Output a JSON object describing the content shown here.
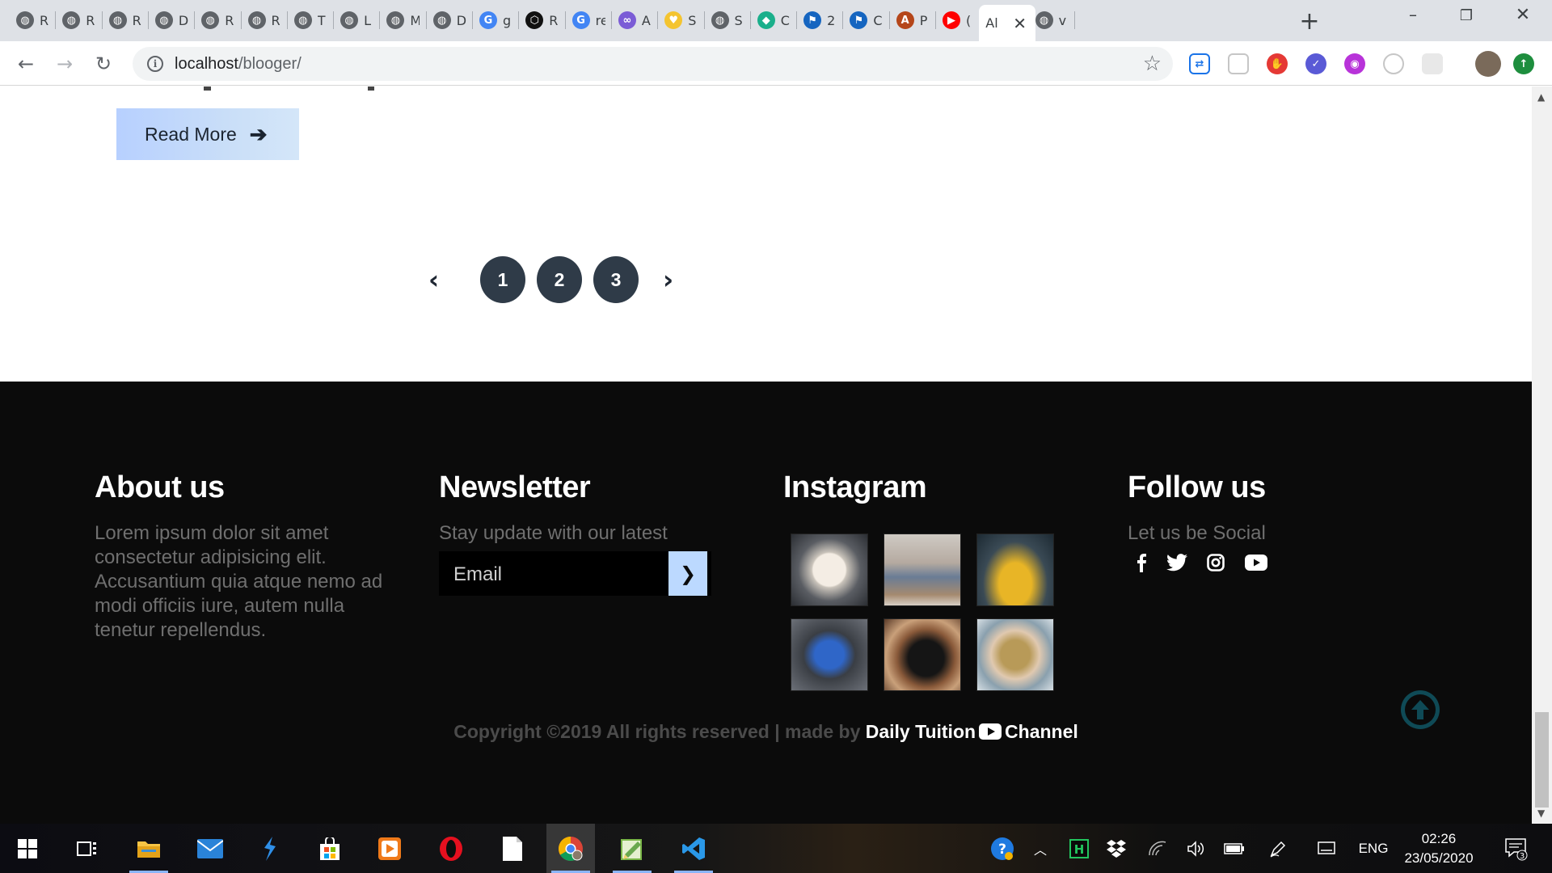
{
  "browser": {
    "tabs": [
      {
        "title": "R",
        "icon": "globe-icon",
        "color": "#5f6368"
      },
      {
        "title": "R",
        "icon": "globe-icon",
        "color": "#5f6368"
      },
      {
        "title": "R",
        "icon": "globe-icon",
        "color": "#5f6368"
      },
      {
        "title": "D",
        "icon": "globe-icon",
        "color": "#5f6368"
      },
      {
        "title": "R",
        "icon": "globe-icon",
        "color": "#5f6368"
      },
      {
        "title": "R",
        "icon": "globe-icon",
        "color": "#5f6368"
      },
      {
        "title": "T",
        "icon": "globe-icon",
        "color": "#5f6368"
      },
      {
        "title": "L",
        "icon": "globe-icon",
        "color": "#5f6368"
      },
      {
        "title": "M",
        "icon": "globe-icon",
        "color": "#5f6368"
      },
      {
        "title": "D",
        "icon": "globe-icon",
        "color": "#5f6368"
      },
      {
        "title": "g",
        "icon": "google-icon",
        "color": "#4285f4"
      },
      {
        "title": "R",
        "icon": "codepen-icon",
        "color": "#111111"
      },
      {
        "title": "re",
        "icon": "google-icon",
        "color": "#4285f4"
      },
      {
        "title": "A",
        "icon": "knot-icon",
        "color": "#7b5cd6"
      },
      {
        "title": "S",
        "icon": "heart-shield-icon",
        "color": "#f4c430"
      },
      {
        "title": "S",
        "icon": "globe-icon",
        "color": "#5f6368"
      },
      {
        "title": "C",
        "icon": "diamond-icon",
        "color": "#1aaf8b"
      },
      {
        "title": "2",
        "icon": "flag-icon",
        "color": "#1565c0"
      },
      {
        "title": "C",
        "icon": "flag-icon",
        "color": "#1565c0"
      },
      {
        "title": "P",
        "icon": "a-logo-icon",
        "color": "#b5461a"
      },
      {
        "title": "(",
        "icon": "youtube-icon",
        "color": "#ff0000"
      },
      {
        "title": "Al",
        "icon": "none",
        "color": "#3c4043"
      },
      {
        "title": "v",
        "icon": "globe-icon",
        "color": "#5f6368"
      }
    ],
    "url_host": "localhost",
    "url_path": "/blooger/"
  },
  "page": {
    "read_more": "Read More",
    "pagination": [
      "1",
      "2",
      "3"
    ],
    "footer": {
      "about_title": "About us",
      "about_text": "Lorem ipsum dolor sit amet consectetur adipisicing elit. Accusantium quia atque nemo ad modi officiis iure, autem nulla tenetur repellendus.",
      "newsletter_title": "Newsletter",
      "newsletter_subtitle": "Stay update with our latest",
      "email_placeholder": "Email",
      "instagram_title": "Instagram",
      "instagram_photos": [
        "poodle-photo",
        "woman-sitting-photo",
        "man-yellow-sweater-photo",
        "blue-toy-car-photo",
        "camera-photo",
        "compass-photo"
      ],
      "follow_title": "Follow us",
      "follow_subtitle": "Let us be Social",
      "social_icons": [
        "facebook-icon",
        "twitter-icon",
        "instagram-icon",
        "youtube-icon"
      ],
      "copyright_prefix": "Copyright ©2019 All rights reserved | made by ",
      "copyright_brand_1": "Daily Tuition",
      "copyright_brand_2": "Channel"
    }
  },
  "taskbar": {
    "apps": [
      "start-icon",
      "task-view-icon",
      "file-explorer-icon",
      "mail-icon",
      "visual-studio-icon",
      "store-icon",
      "media-player-icon",
      "opera-icon",
      "notepad-icon",
      "chrome-icon",
      "notepad-plus-icon",
      "vscode-icon"
    ],
    "language": "ENG",
    "time": "02:26",
    "date": "23/05/2020",
    "notifications": "3"
  }
}
